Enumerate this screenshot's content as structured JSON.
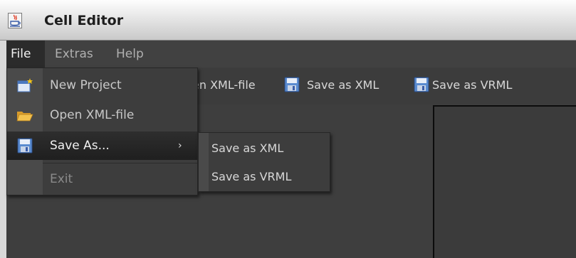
{
  "window": {
    "title": "Cell Editor",
    "app_icon": "java-cup-icon"
  },
  "menubar": {
    "items": [
      {
        "label": "File"
      },
      {
        "label": "Extras"
      },
      {
        "label": "Help"
      }
    ]
  },
  "toolbar": {
    "open_partial_label": "en XML-file",
    "save_xml_label": "Save as XML",
    "save_vrml_label": "Save as VRML",
    "icons": [
      "floppy-disk-icon",
      "floppy-disk-icon"
    ]
  },
  "file_menu": {
    "items": [
      {
        "label": "New Project",
        "icon": "new-project-icon"
      },
      {
        "label": "Open XML-file",
        "icon": "open-folder-icon"
      },
      {
        "label": "Save As...",
        "icon": "floppy-disk-icon",
        "submenu_arrow": "›"
      },
      {
        "label": "Exit"
      }
    ]
  },
  "save_as_submenu": {
    "items": [
      {
        "label": "Save as XML"
      },
      {
        "label": "Save as VRML"
      }
    ]
  },
  "colors": {
    "background": "#3c3c3c",
    "highlight": "#1f1f1f",
    "text": "#d8d8d8",
    "disabled_text": "#8a8a8a"
  }
}
